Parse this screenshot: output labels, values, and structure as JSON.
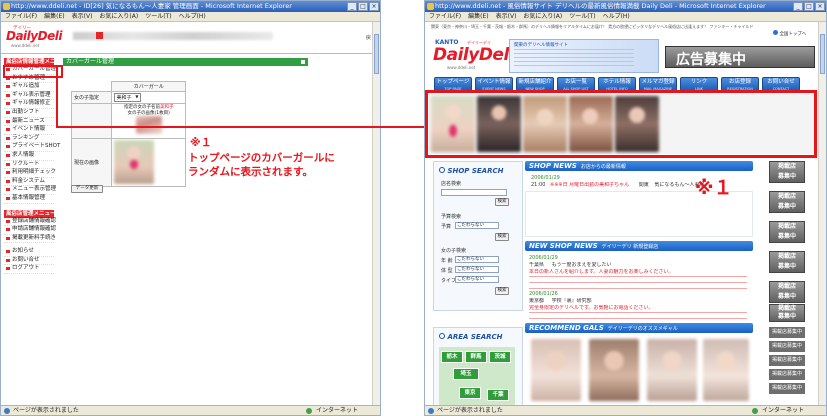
{
  "left_window": {
    "title": "http://www.ddeli.net - ID[26]   気になるもん〜人妻家   管理画面 - Microsoft Internet Explorer",
    "menu": [
      "ファイル(F)",
      "編集(E)",
      "表示(V)",
      "お気に入り(A)",
      "ツール(T)",
      "ヘルプ(H)"
    ],
    "logo_kana": "デイリー",
    "logo": "DailyDeli",
    "logo_url": "www.ddeli.net",
    "header_right": "戻",
    "sidebar_head_1": "風俗店情報管理メニュー",
    "sidebar_items_1": [
      "カバーガール管理",
      "おすすめ管理",
      "ギャル追加",
      "ギャル表示管理",
      "ギャル情報修正",
      "出勤シフト",
      "最新ニュース",
      "イベント情報",
      "ランキング",
      "プライベートSHOT",
      "求人情報",
      "リクルート",
      "利用明細チェック",
      "料金システム",
      "メニュー表示管理",
      "基本情報管理"
    ],
    "sidebar_head_2": "風俗店管理メニュー",
    "sidebar_items_2": [
      "登録店舗情報確認",
      "申請店舗情報確認",
      "掲載更新料手続き"
    ],
    "sidebar_items_3": [
      "お知らせ",
      "お問い合せ",
      "ログアウト"
    ],
    "section_title": "カバーガール管理",
    "table_header": "カバーガール",
    "row1_label": "女の子指定",
    "row1_value": "美和子",
    "row2_line1": "指定の女の子名前",
    "row2_highlight": "美和子",
    "row2_line2": "女の子の画像(1枚目)",
    "row3_label": "現在の画像",
    "update_button": "データ更新",
    "status": "ページが表示されました",
    "zone": "インターネット"
  },
  "callout": {
    "mark_left": "※１",
    "line1": "トップページのカバーガールに",
    "line2": "ランダムに表示されます。",
    "mark_right": "※１",
    "color": "#e8141c"
  },
  "right_window": {
    "title": "http://www.ddeli.net - 風俗情報サイト デリヘルの最新風俗情報満載 Daily Deli - Microsoft Internet Explorer",
    "menu": [
      "ファイル(F)",
      "編集(E)",
      "表示(V)",
      "お気に入り(A)",
      "ツール(T)",
      "ヘルプ(H)"
    ],
    "top_strip": "関東（東京・神奈川・埼玉・千葉・茨城・栃木・群馬）のデリヘル情報をリアルタイムにお届け！ 貴方の欲望にピッタリなデリヘル風俗店に出逢えます！ ファンキー・チャイルド",
    "region": "KANTO",
    "logo_kana": "デイリーデリ",
    "logo": "DailyDeli",
    "logo_url": "www.ddeli.net",
    "top_link": "全国トップへ",
    "banner_desc": "関東のデリヘル情報サイト",
    "ad_banner": "広告募集中",
    "nav": [
      {
        "label": "トップページ",
        "sub": "TOP PAGE"
      },
      {
        "label": "イベント情報",
        "sub": "EVENT NEWS"
      },
      {
        "label": "新規店舗紹介",
        "sub": "NEW SHOP"
      },
      {
        "label": "お店一覧",
        "sub": "ALL SHOP LIST"
      },
      {
        "label": "ホテル情報",
        "sub": "HOTEL INFO"
      },
      {
        "label": "メルマガ登録",
        "sub": "MAIL MAGAZINE"
      },
      {
        "label": "リンク",
        "sub": "LINK"
      },
      {
        "label": "お店登録",
        "sub": "REGISTRATION"
      },
      {
        "label": "お問い合せ",
        "sub": "CONTACT"
      }
    ],
    "shop_search": "SHOP SEARCH",
    "shop_name_label": "店名検索",
    "search_btn": "検索",
    "budget_label": "予算検索",
    "budget_field": "予算",
    "any": "こだわらない",
    "girl_label": "女の子検索",
    "age": "年 齢",
    "body": "体 型",
    "type": "タイプ",
    "shop_news": "SHOP NEWS",
    "shop_news_sub": "お店からの最新情報",
    "shop_news_date": "2006/01/29",
    "shop_news_time": "21:00",
    "shop_news_item": "※※※日 月曜日出勤の美和子ちゃん",
    "shop_news_tag": "関東",
    "shop_news_shop": "気になるもん〜人妻家",
    "new_shop_news": "NEW SHOP NEWS",
    "new_shop_sub": "デイリーデリ 新規登録店",
    "ns_date1": "2006/01/29",
    "ns_area1": "千葉県",
    "ns_shop1": "もう一度おまえを愛したい",
    "ns_text1": "本日の新人さんを紹介します。人妻の魅力をお楽しみください。",
    "ns_date2": "2006/01/26",
    "ns_area2": "東京都",
    "ns_shop2": "学校『裏』研究部",
    "ns_text2": "完全身限定のデリヘルです。お気軽にお電話ください。",
    "recommend": "RECOMMEND GALS",
    "recommend_sub": "デイリーデリのオススメギャル",
    "area_search": "AREA SEARCH",
    "areas": [
      "栃木",
      "群馬",
      "茨城",
      "埼玉",
      "東京",
      "千葉"
    ],
    "right_ads_big": [
      "掲載店\n募集中",
      "掲載店\n募集中",
      "掲載店\n募集中",
      "掲載店\n募集中",
      "掲載店\n募集中",
      "掲載店\n募集中",
      "掲載店\n募集中"
    ],
    "right_ads_small": [
      "掲載店募集中",
      "掲載店募集中",
      "掲載店募集中",
      "掲載店募集中",
      "掲載店募集中"
    ],
    "status": "ページが表示されました",
    "zone": "インターネット"
  }
}
